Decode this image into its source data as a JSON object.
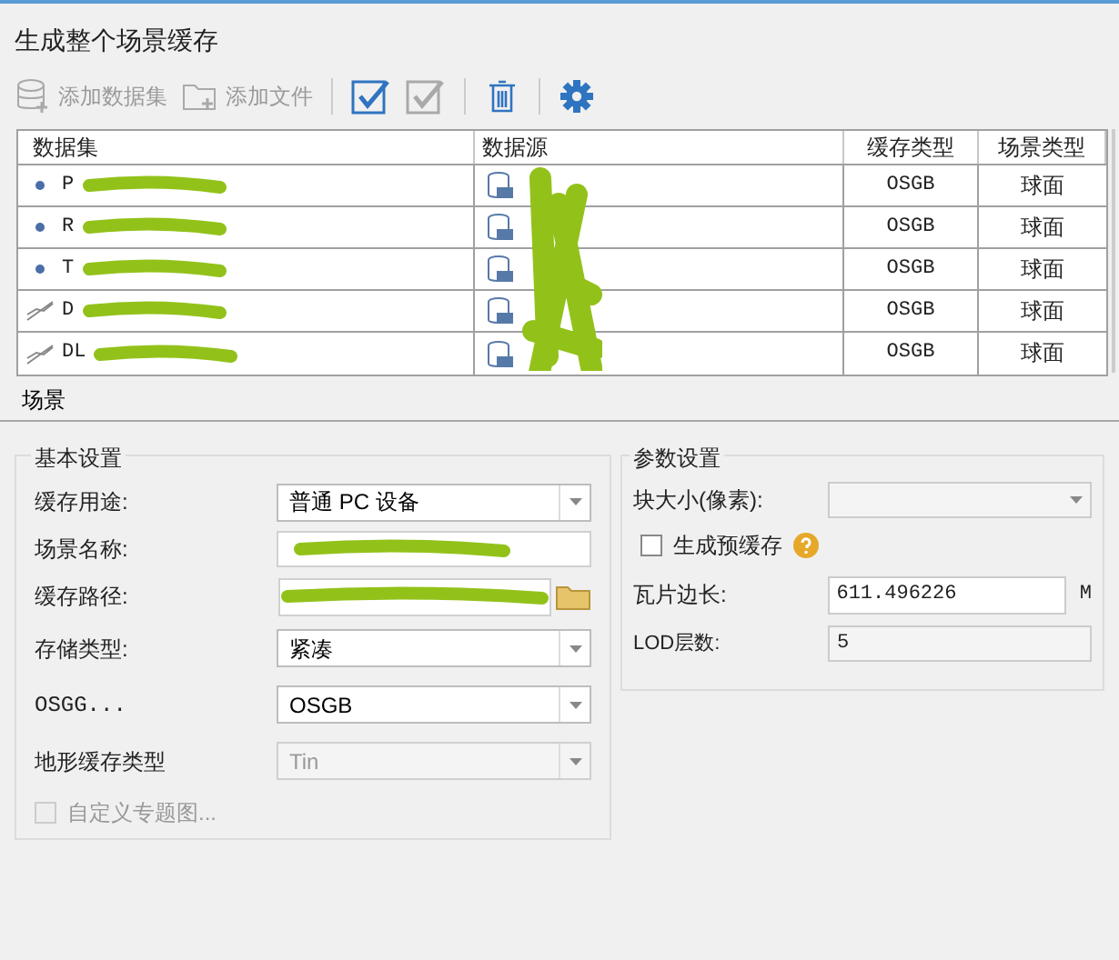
{
  "window": {
    "title": "生成整个场景缓存"
  },
  "toolbar": [
    {
      "kind": "add-dataset",
      "label": "添加数据集",
      "disabled": true
    },
    {
      "kind": "add-file",
      "label": "添加文件",
      "disabled": true
    },
    {
      "kind": "select-all",
      "disabled": false
    },
    {
      "kind": "select-none",
      "disabled": true
    },
    {
      "kind": "delete",
      "disabled": false
    },
    {
      "kind": "settings",
      "disabled": false
    }
  ],
  "table": {
    "columns": [
      "数据集",
      "数据源",
      "缓存类型",
      "场景类型"
    ],
    "rows": [
      {
        "kind": "point",
        "dataset": "P",
        "cache_type": "OSGB",
        "scene_type": "球面"
      },
      {
        "kind": "point",
        "dataset": "R",
        "cache_type": "OSGB",
        "scene_type": "球面"
      },
      {
        "kind": "point",
        "dataset": "T",
        "cache_type": "OSGB",
        "scene_type": "球面"
      },
      {
        "kind": "line",
        "dataset": "D",
        "cache_type": "OSGB",
        "scene_type": "球面"
      },
      {
        "kind": "line",
        "dataset": "DL",
        "cache_type": "OSGB",
        "scene_type": "球面"
      }
    ]
  },
  "tabs": [
    {
      "label": "场景",
      "selected": true
    }
  ],
  "basic": {
    "title": "基本设置",
    "fields": [
      {
        "kind": "select",
        "label": "缓存用途:",
        "value": "普通 PC 设备",
        "disabled": false
      },
      {
        "kind": "text",
        "label": "场景名称:"
      },
      {
        "kind": "path",
        "label": "缓存路径:"
      },
      {
        "kind": "select",
        "label": "存储类型:",
        "value": "紧凑",
        "disabled": false
      },
      {
        "kind": "select",
        "label": "OSGG...",
        "value": "OSGB",
        "disabled": false
      },
      {
        "kind": "select",
        "label": "地形缓存类型",
        "value": "Tin",
        "disabled": true
      }
    ],
    "custom_theme": {
      "label": "自定义专题图...",
      "checked": false,
      "disabled": true
    }
  },
  "params": {
    "title": "参数设置",
    "block_size": {
      "label": "块大小(像素):",
      "disabled": true
    },
    "pre_cache": {
      "label": "生成预缓存",
      "checked": false
    },
    "tile_length": {
      "label": "瓦片边长:",
      "value": "611.496226",
      "unit": "M"
    },
    "lod": {
      "label": "LOD层数:",
      "value": "5",
      "disabled": true
    }
  }
}
